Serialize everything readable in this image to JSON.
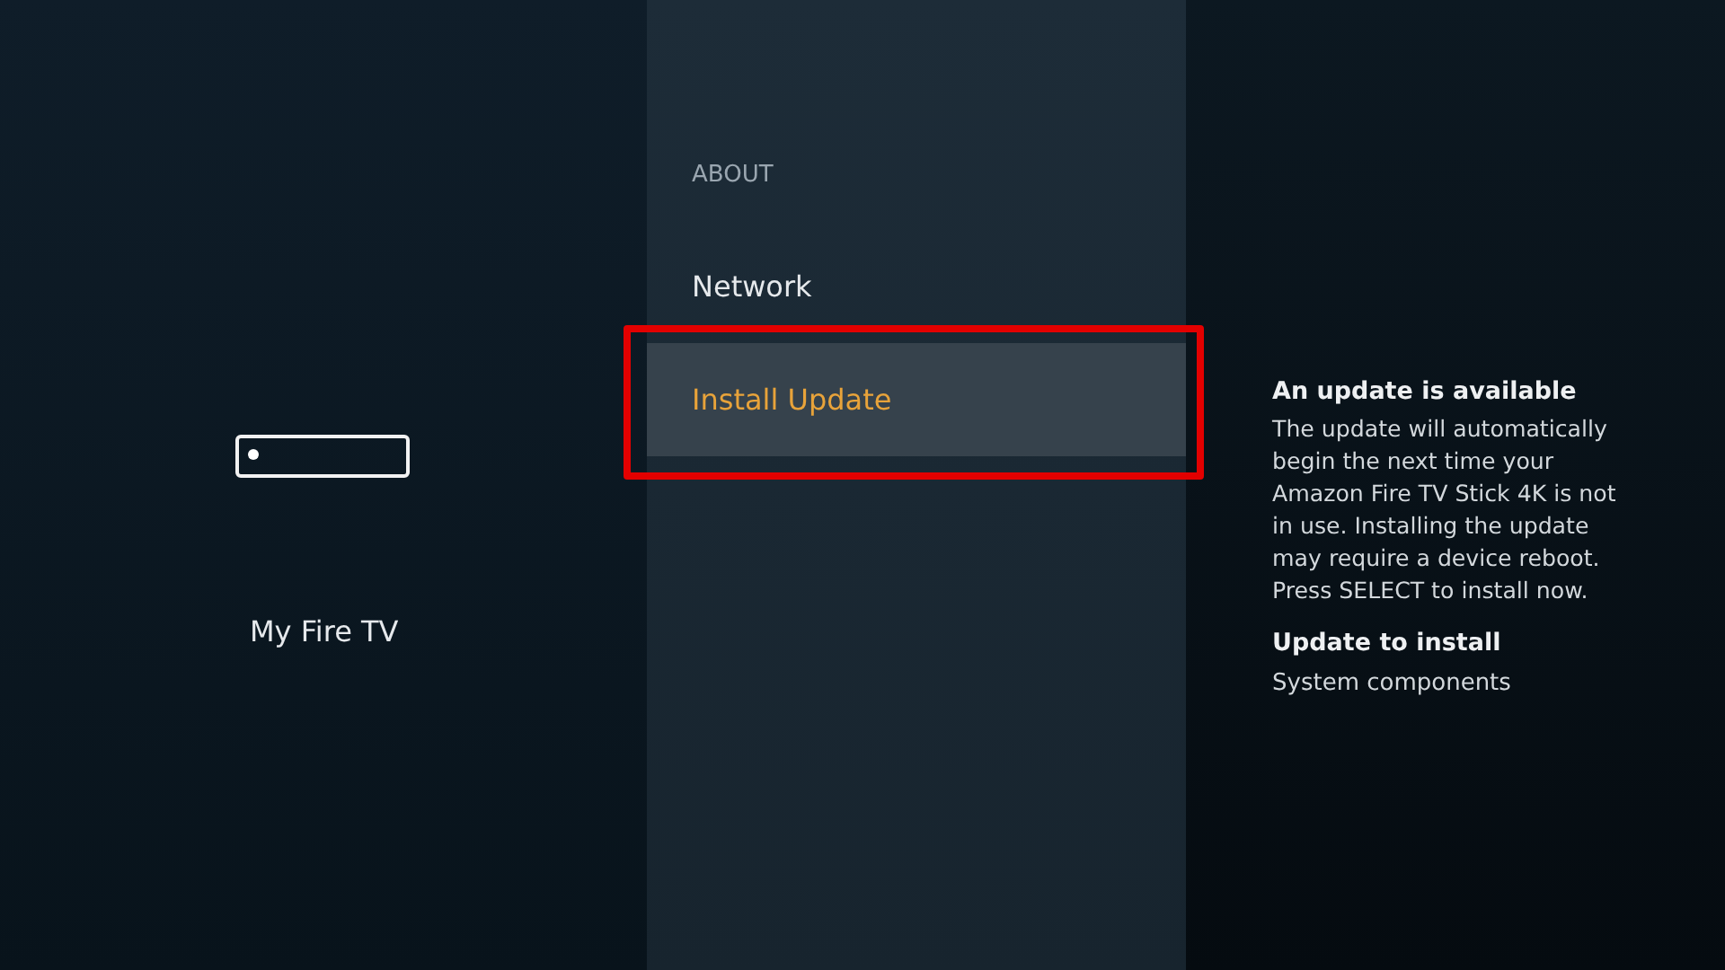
{
  "left_panel": {
    "title": "My Fire TV"
  },
  "menu": {
    "section_heading": "ABOUT",
    "items": [
      {
        "label": "Network",
        "selected": false,
        "marked": false
      },
      {
        "label": "Install Update",
        "selected": true,
        "marked": true
      }
    ]
  },
  "details": {
    "heading": "An update is available",
    "body": "The update will automatically begin the next time your Amazon Fire TV Stick 4K is not in use. Installing the update may require a device reboot. Press SELECT to install now.",
    "subheading": "Update to install",
    "value": "System components"
  }
}
